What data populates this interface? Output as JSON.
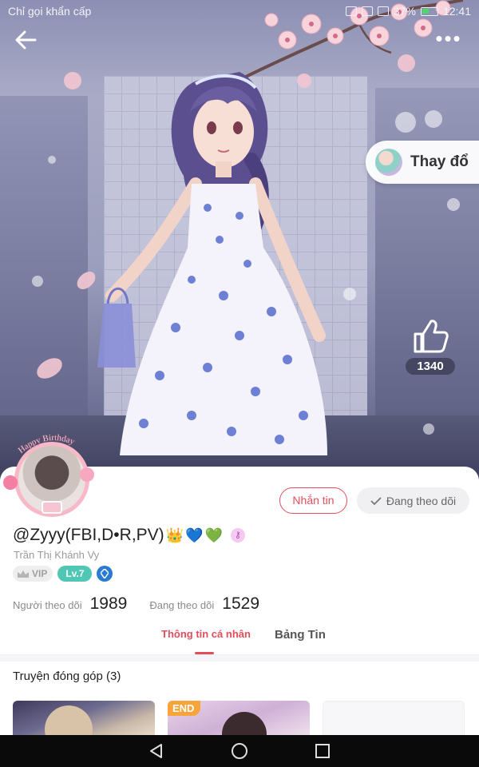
{
  "status_bar": {
    "carrier": "Chỉ gọi khẩn cấp",
    "battery": "37%",
    "time": "12:41"
  },
  "header": {
    "back_icon": "arrow-left-icon",
    "more_icon": "more-horizontal-icon",
    "more_label": "•••"
  },
  "hero": {
    "change_outfit_label": "Thay đổ",
    "like_icon": "thumbs-up-icon",
    "like_count": "1340"
  },
  "profile": {
    "avatar_banner": "Happy Birthday",
    "message_button": "Nhắn tin",
    "following_button": "Đang theo dõi",
    "username": "@Zyyy(FBI,D•R,PV)",
    "username_emojis": [
      "👑",
      "💙",
      "💚"
    ],
    "key_badge": "⚷",
    "real_name": "Trần Thị Khánh Vy",
    "vip_label": "VIP",
    "level_label": "Lv.7",
    "followers_label": "Người theo dõi",
    "followers_count": "1989",
    "following_label": "Đang theo dõi",
    "following_count": "1529"
  },
  "tabs": {
    "personal_info": "Thông tin cá nhân",
    "news_feed": "Bảng Tin"
  },
  "stories": {
    "section_title": "Truyện đóng góp (3)",
    "items": [
      {
        "badge": ""
      },
      {
        "badge": "END"
      },
      {
        "badge": ""
      }
    ]
  },
  "colors": {
    "accent": "#e24d5c",
    "level_badge": "#4fc7b4",
    "end_badge": "#f7a43a"
  }
}
